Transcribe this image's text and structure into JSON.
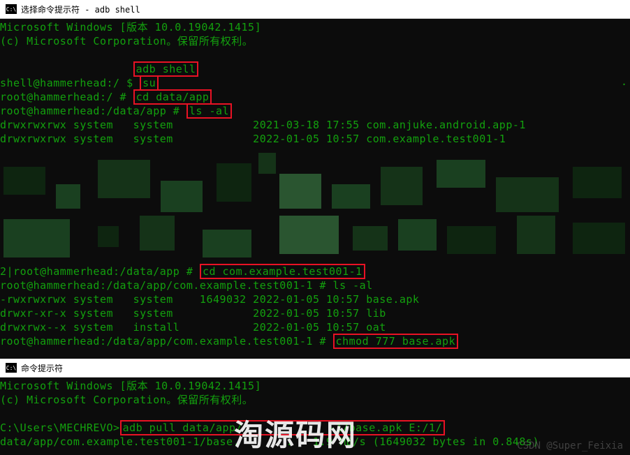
{
  "window1": {
    "title": "选择命令提示符 - adb  shell",
    "lines": {
      "ver": "Microsoft Windows [版本 10.0.19042.1415]",
      "copyright": "(c) Microsoft Corporation。保留所有权利。",
      "adb_cmd": "adb shell",
      "prompt1": "shell@hammerhead:/ $ ",
      "su_cmd": "su",
      "prompt2": "root@hammerhead:/ # ",
      "cd1_cmd": "cd data/app",
      "prompt3": "root@hammerhead:/data/app # ",
      "ls1_cmd": "ls -al",
      "ls1_row1": "drwxrwxrwx system   system            2021-03-18 17:55 com.anjuke.android.app-1",
      "ls1_row2": "drwxrwxrwx system   system            2022-01-05 10:57 com.example.test001-1",
      "prompt4": "2|root@hammerhead:/data/app # ",
      "cd2_cmd": "cd com.example.test001-1",
      "prompt5": "root@hammerhead:/data/app/com.example.test001-1 # ls -al",
      "ls2_row1": "-rwxrwxrwx system   system    1649032 2022-01-05 10:57 base.apk",
      "ls2_row2": "drwxr-xr-x system   system            2022-01-05 10:57 lib",
      "ls2_row3": "drwxrwx--x system   install           2022-01-05 10:57 oat",
      "prompt6": "root@hammerhead:/data/app/com.example.test001-1 # ",
      "chmod_cmd": "chmod 777 base.apk"
    }
  },
  "window2": {
    "title": "命令提示符",
    "lines": {
      "ver": "Microsoft Windows [版本 10.0.19042.1415]",
      "copyright": "(c) Microsoft Corporation。保留所有权利。",
      "prompt": "C:\\Users\\MECHREVO>",
      "pull_cmd_a": "adb pull data/app/",
      "pull_cmd_b": "-1/base.apk E:/1/",
      "result": "data/app/com.example.test001-1/base.       .   1.9 MB/s (1649032 bytes in 0.848s)"
    }
  },
  "watermarks": {
    "site": "淘源码网",
    "author": "CSDN @Super_Feixia"
  }
}
